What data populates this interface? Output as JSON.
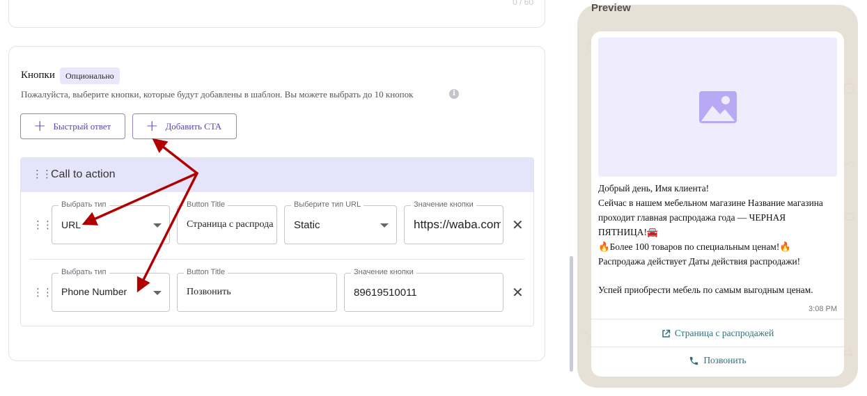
{
  "top_card": {
    "counter": "0 / 60"
  },
  "buttons_section": {
    "title": "Кнопки",
    "badge": "Опционально",
    "description": "Пожалуйста, выберите кнопки, которые будут добавлены в шаблон. Вы можете выбрать до 10 кнопок",
    "info_icon": "i",
    "quick_reply_label": "Быстрый ответ",
    "add_cta_label": "Добавить CTA"
  },
  "cta": {
    "title": "Call to action",
    "rows": [
      {
        "type_label": "Выбрать тип",
        "type_value": "URL",
        "title_label": "Button Title",
        "title_value": "Страница с распродажей",
        "url_type_label": "Выберите тип URL",
        "url_type_value": "Static",
        "value_label": "Значение кнопки",
        "value": "https://waba.com"
      },
      {
        "type_label": "Выбрать тип",
        "type_value": "Phone Number",
        "title_label": "Button Title",
        "title_value": "Позвонить",
        "value_label": "Значение кнопки",
        "value": "89619510011"
      }
    ],
    "remove_icon": "✕"
  },
  "preview": {
    "title": "Preview",
    "message_lines": [
      "Добрый день, Имя клиента!",
      "Сейчас в нашем мебельном магазине Название магазина",
      "проходит главная распродажа года — ЧЕРНАЯ",
      "ПЯТНИЦА!🚘",
      "🔥Более 100 товаров по специальным ценам!🔥",
      "Распродажа действует Даты действия распродажи!",
      "",
      "Успей приобрести мебель по самым выгодным ценам."
    ],
    "time": "3:08 PM",
    "buttons": [
      {
        "icon": "external-link-icon",
        "label": "Страница с распродажей"
      },
      {
        "icon": "phone-icon",
        "label": "Позвонить"
      }
    ]
  },
  "colors": {
    "accent": "#5147b5",
    "annotation_arrow": "#b00000",
    "cta_header": "#e6e4fb",
    "preview_link": "#2f6f7a"
  }
}
